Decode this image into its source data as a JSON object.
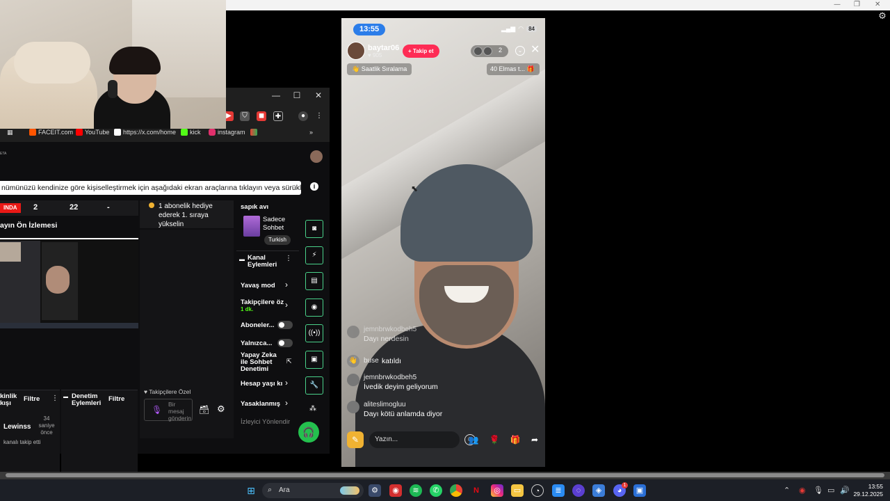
{
  "browser": {
    "bookmarks": [
      {
        "label": "FACEIT.com",
        "color": "#ff5500"
      },
      {
        "label": "YouTube",
        "color": "#ff0000"
      },
      {
        "label": "https://x.com/home",
        "color": "#ffffff"
      },
      {
        "label": "kick",
        "color": "#53fc18"
      },
      {
        "label": "instagram",
        "color": "#e1306c"
      }
    ],
    "window_controls": {
      "minimize": "—",
      "maximize": "☐",
      "close": "✕"
    }
  },
  "dashboard": {
    "tip_text": "nümünüzü kendinize göre kişiselleştirmek için aşağıdaki ekran araçlarına tıklayın veya sürükleyin",
    "stats": {
      "live": "INDA",
      "s1": "2",
      "s2": "22",
      "s3": "-"
    },
    "preview_title": "ayın Ön İzlemesi",
    "sub_promo": "1 abonelik hediye ederek 1. sıraya yükselin",
    "stream_info": {
      "title": "sapık avı",
      "category": "Sadece Sohbet",
      "tag": "Turkish"
    },
    "channel_actions": {
      "header": "Kanal Eylemleri",
      "items": [
        {
          "label": "Yavaş mod"
        },
        {
          "label": "Takipçilere öz",
          "sub": "1 dk."
        },
        {
          "label": "Aboneler..."
        },
        {
          "label": "Yalnızca..."
        },
        {
          "label": "Yapay Zeka ile Sohbet Denetimi"
        },
        {
          "label": "Hesap yaşı kı"
        },
        {
          "label": "Yasaklanmış"
        },
        {
          "label": "İzleyici Yönlendir"
        }
      ]
    },
    "activity": {
      "header": "kinlik kışı",
      "filter": "Filtre",
      "user": "Lewinss",
      "time": "34 saniye önce",
      "event": "kanalı takip etti"
    },
    "moderation": {
      "header": "Denetim Eylemleri",
      "filter": "Filtre"
    },
    "chat": {
      "followers_only": "Takipçilere Özel",
      "placeholder": "Bir mesaj gönderin"
    }
  },
  "phone": {
    "time": "13:55",
    "battery": "84",
    "host": {
      "name": "baytar06",
      "likes": "905"
    },
    "follow_label": "Takip et",
    "viewer_count": "2",
    "rank_label": "Saatlik Sıralama",
    "gift_label": "40 Elmas t...",
    "messages": [
      {
        "user": "jemnbrwkodbeh5",
        "text": "Dayı nerdesin"
      },
      {
        "user": "buse",
        "text": "katıldı"
      },
      {
        "user": "jemnbrwkodbeh5",
        "text": "İvedik deyim geliyorum"
      },
      {
        "user": "aliteslimogluu",
        "text": "Dayı kötü anlamda diyor"
      }
    ],
    "input_placeholder": "Yazın..."
  },
  "taskbar": {
    "search_label": "Ara",
    "time": "13:55",
    "date": "29.12.2025",
    "discord_badge": "1"
  }
}
